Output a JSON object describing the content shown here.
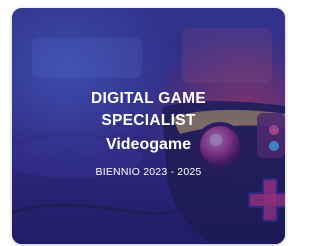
{
  "card": {
    "title_line1": "DIGITAL GAME",
    "title_line2": "SPECIALIST",
    "subtitle": "Videogame",
    "period": "BIENNIO 2023 - 2025"
  },
  "colors": {
    "overlay": "#2a2a8c",
    "text": "#ffffff"
  },
  "icons": {
    "background": "gaming-controller-photo"
  }
}
